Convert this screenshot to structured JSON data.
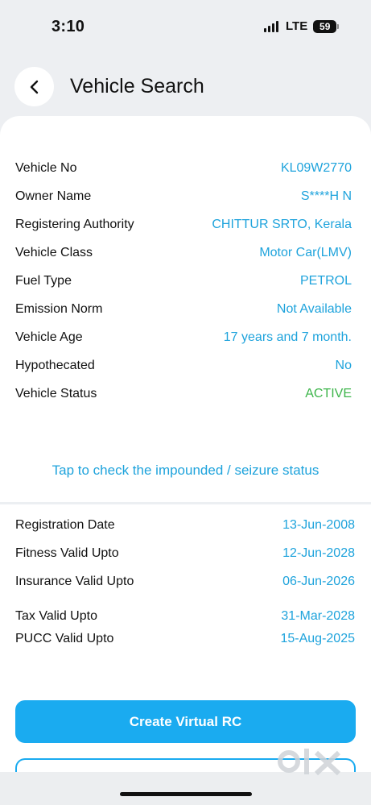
{
  "status_bar": {
    "time": "3:10",
    "network": "LTE",
    "battery": "59"
  },
  "header": {
    "title": "Vehicle Search"
  },
  "icons": {
    "back": "chevron-left-icon",
    "signal": "signal-bars-icon",
    "battery": "battery-icon"
  },
  "vehicle": [
    {
      "label": "Vehicle No",
      "value": "KL09W2770"
    },
    {
      "label": "Owner Name",
      "value": "S****H N"
    },
    {
      "label": "Registering Authority",
      "value": "CHITTUR SRTO, Kerala"
    },
    {
      "label": "Vehicle Class",
      "value": "Motor Car(LMV)"
    },
    {
      "label": "Fuel Type",
      "value": "PETROL"
    },
    {
      "label": "Emission Norm",
      "value": "Not Available"
    },
    {
      "label": "Vehicle Age",
      "value": "17 years and 7 month."
    },
    {
      "label": "Hypothecated",
      "value": "No"
    },
    {
      "label": "Vehicle Status",
      "value": "ACTIVE"
    }
  ],
  "impound_link": "Tap to check the impounded / seizure status",
  "validity": [
    {
      "label": "Registration Date",
      "value": "13-Jun-2008"
    },
    {
      "label": "Fitness Valid Upto",
      "value": "12-Jun-2028"
    },
    {
      "label": "Insurance Valid Upto",
      "value": "06-Jun-2026"
    },
    {
      "label": "Tax Valid Upto",
      "value": "31-Mar-2028"
    },
    {
      "label": "PUCC Valid Upto",
      "value": "15-Aug-2025"
    }
  ],
  "buttons": {
    "create_virtual_rc": "Create Virtual RC"
  },
  "colors": {
    "accent": "#1ea3dc",
    "button": "#1aabf0",
    "active": "#3cb54a"
  },
  "watermark": "OLX"
}
